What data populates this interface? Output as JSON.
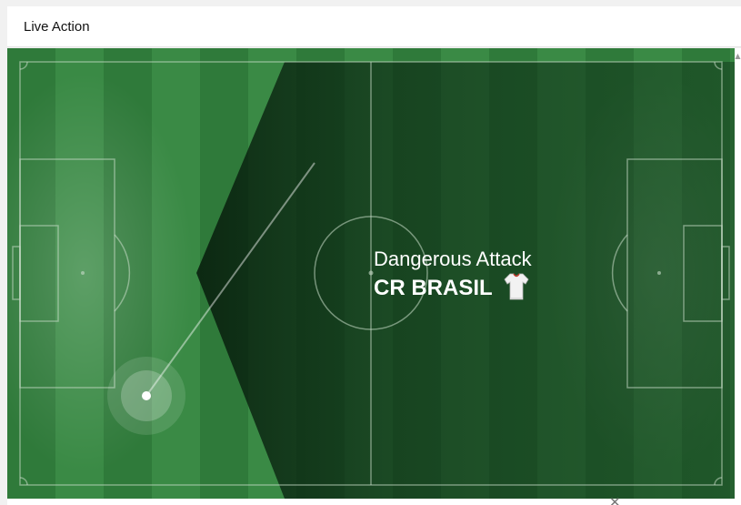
{
  "panel": {
    "title": "Live Action"
  },
  "event": {
    "type": "Dangerous Attack",
    "team": "CR BRASIL",
    "team_icon": "jersey-icon",
    "attacking_direction": "left"
  },
  "colors": {
    "pitch_light": "#3a8a45",
    "pitch_dark": "#2f7a3a",
    "overlay": "#0b2a14",
    "lines": "#c9dcc9"
  }
}
